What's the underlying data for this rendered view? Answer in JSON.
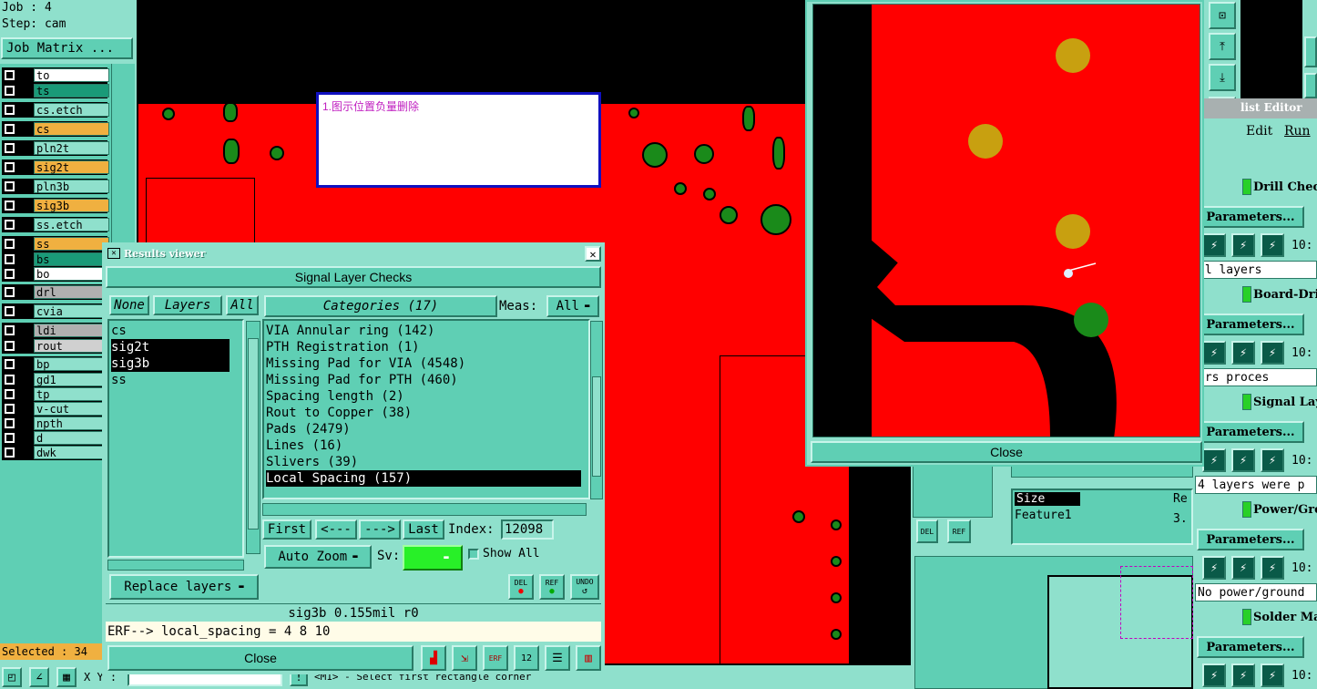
{
  "left_panel": {
    "job": "Job : 4",
    "step": "Step: cam",
    "job_matrix": "Job Matrix ...",
    "selected": "Selected : 34",
    "xy_label": "X Y :"
  },
  "layers": [
    {
      "name": "to",
      "bg": "#ffffff"
    },
    {
      "name": "ts",
      "bg": "#1a9a78"
    },
    {
      "name": "cs.etch",
      "bg": "#8fe0cc"
    },
    {
      "name": "cs",
      "bg": "#f0b040"
    },
    {
      "name": "pln2t",
      "bg": "#8fe0cc"
    },
    {
      "name": "sig2t",
      "bg": "#f0b040"
    },
    {
      "name": "pln3b",
      "bg": "#8fe0cc"
    },
    {
      "name": "sig3b",
      "bg": "#f0b040"
    },
    {
      "name": "ss.etch",
      "bg": "#8fe0cc"
    },
    {
      "name": "ss",
      "bg": "#f0b040"
    },
    {
      "name": "bs",
      "bg": "#1a9a78"
    },
    {
      "name": "bo",
      "bg": "#ffffff"
    },
    {
      "name": "drl",
      "bg": "#b0b0b0"
    },
    {
      "name": "cvia",
      "bg": "#8fe0cc"
    },
    {
      "name": "ldi",
      "bg": "#b0b0b0"
    },
    {
      "name": "rout",
      "bg": "#d0d0d0"
    },
    {
      "name": "bp",
      "bg": "#8fe0cc"
    },
    {
      "name": "gd1",
      "bg": "#8fe0cc"
    },
    {
      "name": "tp",
      "bg": "#8fe0cc"
    },
    {
      "name": "v-cut",
      "bg": "#8fe0cc"
    },
    {
      "name": "npth",
      "bg": "#8fe0cc"
    },
    {
      "name": "d",
      "bg": "#8fe0cc"
    },
    {
      "name": "dwk",
      "bg": "#8fe0cc"
    }
  ],
  "annotation": "1.图示位置负量删除",
  "results_viewer": {
    "title": "Results viewer",
    "header": "Signal Layer Checks",
    "none_btn": "None",
    "layers_btn": "Layers",
    "all_btn": "All",
    "categories_btn": "Categories (17)",
    "meas_label": "Meas:",
    "meas_value": "All",
    "layer_list": [
      "cs",
      "sig2t",
      "sig3b",
      "ss"
    ],
    "categories": [
      "VIA Annular ring (142)",
      "PTH Registration (1)",
      "Missing Pad for VIA (4548)",
      "Missing Pad for PTH (460)",
      "Spacing length (2)",
      "Rout to Copper (38)",
      "Pads (2479)",
      "Lines (16)",
      "Slivers (39)",
      "Local Spacing (157)"
    ],
    "first": "First",
    "prev": "<---",
    "next": "--->",
    "last": "Last",
    "index_label": "Index:",
    "index_value": "12098",
    "auto_zoom": "Auto Zoom",
    "sv_label": "Sv:",
    "show_all": "Show All",
    "replace_layers": "Replace layers",
    "del": "DEL",
    "ref": "REF",
    "undo": "UNDO",
    "status": "sig3b 0.155mil  r0",
    "erf": "ERF--> local_spacing = 4 8 10",
    "close": "Close"
  },
  "zoom_window": {
    "close": "Close"
  },
  "checklist": {
    "title": "list Editor",
    "menu_edit": "Edit",
    "menu_run": "Run",
    "items": [
      {
        "name": "Drill Check",
        "msg": "ll layers"
      },
      {
        "name": "Board-Dril",
        "msg": "ers proces"
      },
      {
        "name": "Signal Laye",
        "msg": "4 layers were p"
      },
      {
        "name": "Power/Groun",
        "msg": "No power/ground"
      },
      {
        "name": "Solder Mas",
        "msg": ""
      }
    ],
    "params": "Parameters...",
    "time": "10:"
  },
  "mid_panel": {
    "size": "Size",
    "feature": "Feature1",
    "re": "Re",
    "val": "3."
  },
  "prompt": "<M1> - Select first rectangle corner"
}
